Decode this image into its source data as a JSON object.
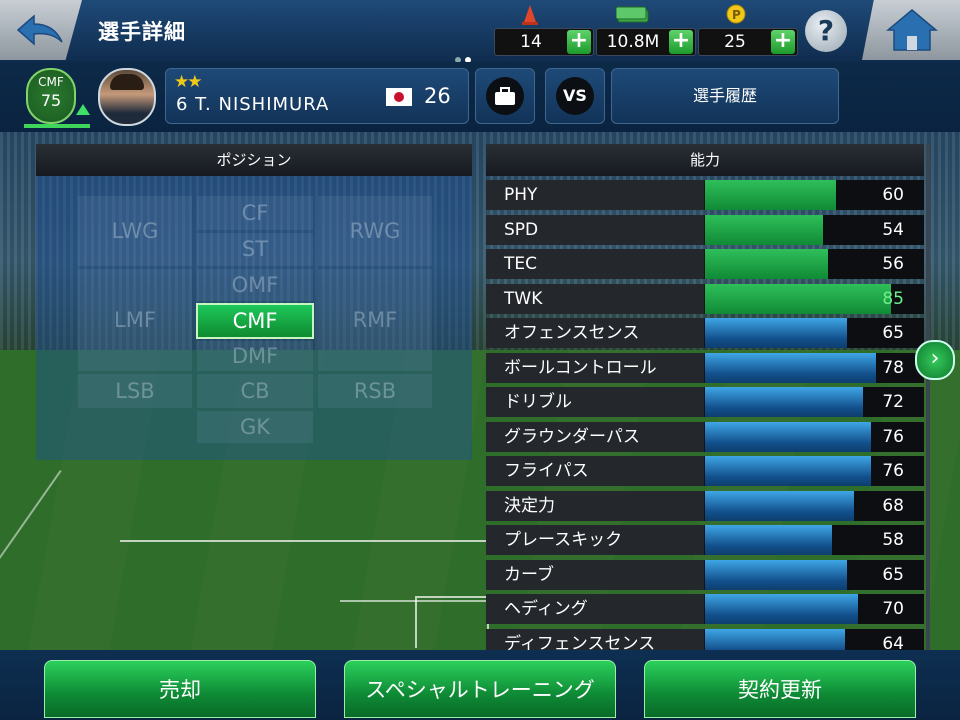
{
  "header": {
    "title": "選手詳細",
    "back_icon": "back-arrow-icon",
    "home_icon": "home-icon",
    "help_label": "?",
    "currencies": [
      {
        "name": "cone",
        "icon": "cone-icon",
        "value": "14",
        "color": "#e0462a"
      },
      {
        "name": "cash",
        "icon": "cash-icon",
        "value": "10.8M",
        "color": "#3caa48"
      },
      {
        "name": "points",
        "icon": "coin-icon",
        "value": "25",
        "color": "#f2c818"
      }
    ],
    "add_label": "+"
  },
  "player": {
    "position": "CMF",
    "rating": "75",
    "stars": "★★",
    "name": "6 T. NISHIMURA",
    "nationality_icon": "japan-flag-icon",
    "age": "26",
    "condition_icon": "arrow-up-icon",
    "buttons": {
      "contract_icon": "briefcase-icon",
      "vs_label": "VS",
      "history_label": "選手履歴"
    }
  },
  "positions": {
    "header": "ポジション",
    "cells": [
      {
        "id": "LWG",
        "label": "LWG",
        "active": false
      },
      {
        "id": "CF",
        "label": "CF",
        "active": false
      },
      {
        "id": "RWG",
        "label": "RWG",
        "active": false
      },
      {
        "id": "ST",
        "label": "ST",
        "active": false
      },
      {
        "id": "OMF",
        "label": "OMF",
        "active": false
      },
      {
        "id": "LMF",
        "label": "LMF",
        "active": false
      },
      {
        "id": "CMF",
        "label": "CMF",
        "active": true
      },
      {
        "id": "RMF",
        "label": "RMF",
        "active": false
      },
      {
        "id": "DMF",
        "label": "DMF",
        "active": false
      },
      {
        "id": "LSB",
        "label": "LSB",
        "active": false
      },
      {
        "id": "CB",
        "label": "CB",
        "active": false
      },
      {
        "id": "RSB",
        "label": "RSB",
        "active": false
      },
      {
        "id": "GK",
        "label": "GK",
        "active": false
      }
    ]
  },
  "abilities": {
    "header": "能力",
    "max": 100,
    "rows": [
      {
        "label": "PHY",
        "value": 60,
        "kind": "green"
      },
      {
        "label": "SPD",
        "value": 54,
        "kind": "green"
      },
      {
        "label": "TEC",
        "value": 56,
        "kind": "green"
      },
      {
        "label": "TWK",
        "value": 85,
        "kind": "green",
        "highlight": true
      },
      {
        "label": "オフェンスセンス",
        "value": 65,
        "kind": "blue"
      },
      {
        "label": "ボールコントロール",
        "value": 78,
        "kind": "blue"
      },
      {
        "label": "ドリブル",
        "value": 72,
        "kind": "blue"
      },
      {
        "label": "グラウンダーパス",
        "value": 76,
        "kind": "blue"
      },
      {
        "label": "フライパス",
        "value": 76,
        "kind": "blue"
      },
      {
        "label": "決定力",
        "value": 68,
        "kind": "blue"
      },
      {
        "label": "プレースキック",
        "value": 58,
        "kind": "blue"
      },
      {
        "label": "カーブ",
        "value": 65,
        "kind": "blue"
      },
      {
        "label": "ヘディング",
        "value": 70,
        "kind": "blue"
      },
      {
        "label": "ディフェンスセンス",
        "value": 64,
        "kind": "blue"
      }
    ],
    "next_icon": "chevron-right-icon"
  },
  "footer": {
    "sell_label": "売却",
    "training_label": "スペシャルトレーニング",
    "renew_label": "契約更新"
  }
}
